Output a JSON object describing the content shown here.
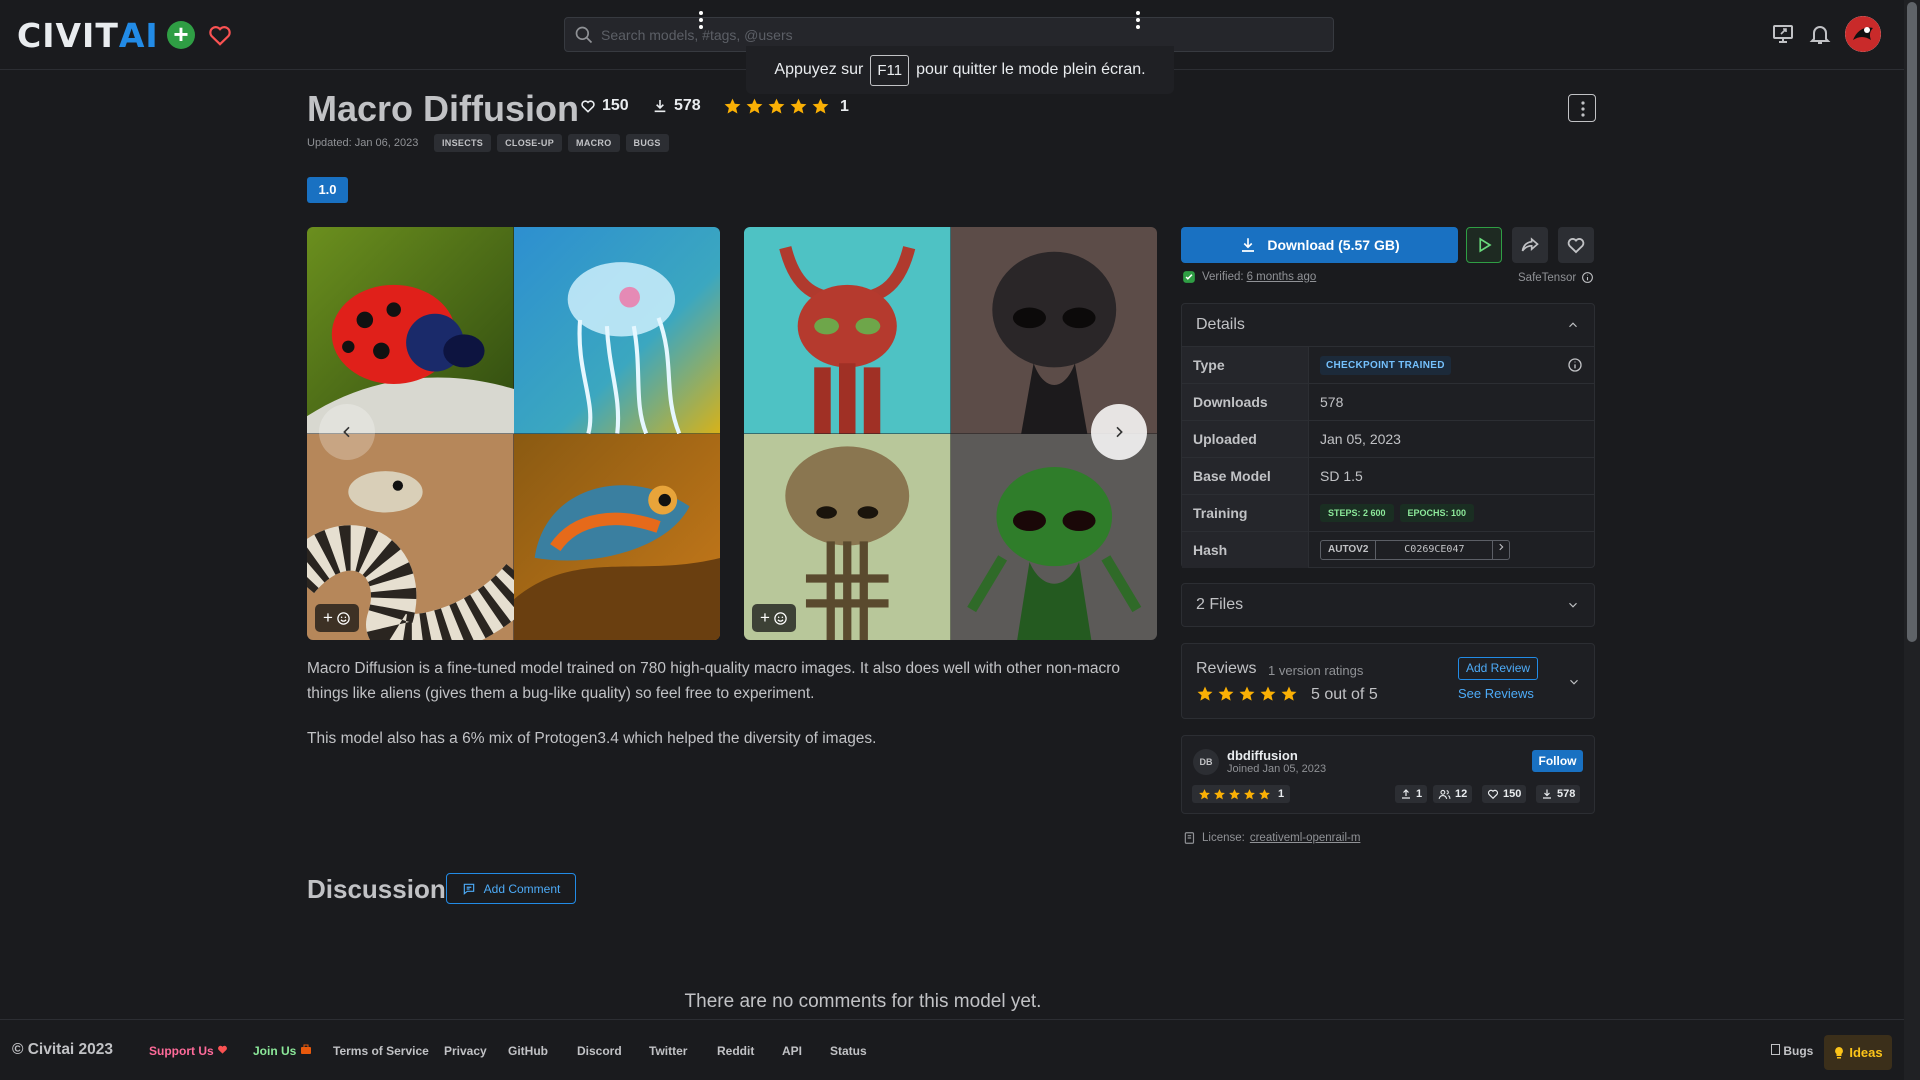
{
  "header": {
    "logo_main": "CIVIT",
    "logo_accent": "AI",
    "search_placeholder": "Search models, #tags, @users"
  },
  "fullscreen_notice": {
    "before": "Appuyez sur",
    "key": "F11",
    "after": "pour quitter le mode plein écran."
  },
  "model": {
    "title": "Macro Diffusion",
    "likes": "150",
    "downloads": "578",
    "rating_count": "1",
    "rating_stars": 5,
    "updated": "Updated: Jan 06, 2023",
    "tags": [
      "INSECTS",
      "CLOSE-UP",
      "MACRO",
      "BUGS"
    ],
    "version": "1.0"
  },
  "gallery": {
    "card1": [
      "ladybug",
      "jellyfish",
      "snake",
      "chameleon"
    ],
    "card2": [
      "red-alien",
      "dark-alien",
      "tan-alien",
      "green-alien"
    ]
  },
  "description": [
    "Macro Diffusion is a fine-tuned model trained on 780 high-quality macro images. It also does well with other non-macro things like aliens (gives them a bug-like quality) so feel free to experiment.",
    "This model also has a 6% mix of Protogen3.4 which helped the diversity of images."
  ],
  "sidebar": {
    "download_label": "Download (5.57 GB)",
    "verified_prefix": "Verified:",
    "verified_when": "6 months ago",
    "safetensor": "SafeTensor",
    "details_title": "Details",
    "details": {
      "type_label": "Type",
      "type_value": "CHECKPOINT TRAINED",
      "downloads_label": "Downloads",
      "downloads_value": "578",
      "uploaded_label": "Uploaded",
      "uploaded_value": "Jan 05, 2023",
      "base_label": "Base Model",
      "base_value": "SD 1.5",
      "training_label": "Training",
      "steps": "STEPS: 2 600",
      "epochs": "EPOCHS: 100",
      "hash_label": "Hash",
      "hash_algo": "AUTOV2",
      "hash_value": "C0269CE047"
    },
    "files_title": "2 Files",
    "reviews": {
      "title": "Reviews",
      "subtitle": "1 version ratings",
      "score": "5 out of 5",
      "stars": 5,
      "add_review": "Add Review",
      "see_reviews": "See Reviews"
    },
    "creator": {
      "initials": "DB",
      "name": "dbdiffusion",
      "joined": "Joined Jan 05, 2023",
      "follow": "Follow",
      "rating_count": "1",
      "uploads": "1",
      "followers": "12",
      "likes": "150",
      "downloads": "578"
    },
    "license_prefix": "License:",
    "license_name": "creativeml-openrail-m"
  },
  "discussion": {
    "title": "Discussion",
    "add_comment": "Add Comment",
    "empty": "There are no comments for this model yet."
  },
  "footer": {
    "copyright": "© Civitai 2023",
    "support": "Support Us",
    "join": "Join Us",
    "tos": "Terms of Service",
    "privacy": "Privacy",
    "github": "GitHub",
    "discord": "Discord",
    "twitter": "Twitter",
    "reddit": "Reddit",
    "api": "API",
    "status": "Status",
    "bugs": "Bugs",
    "ideas": "Ideas"
  },
  "colors": {
    "accent": "#1971c2",
    "star": "#fab005",
    "background": "#1a1b1e"
  }
}
